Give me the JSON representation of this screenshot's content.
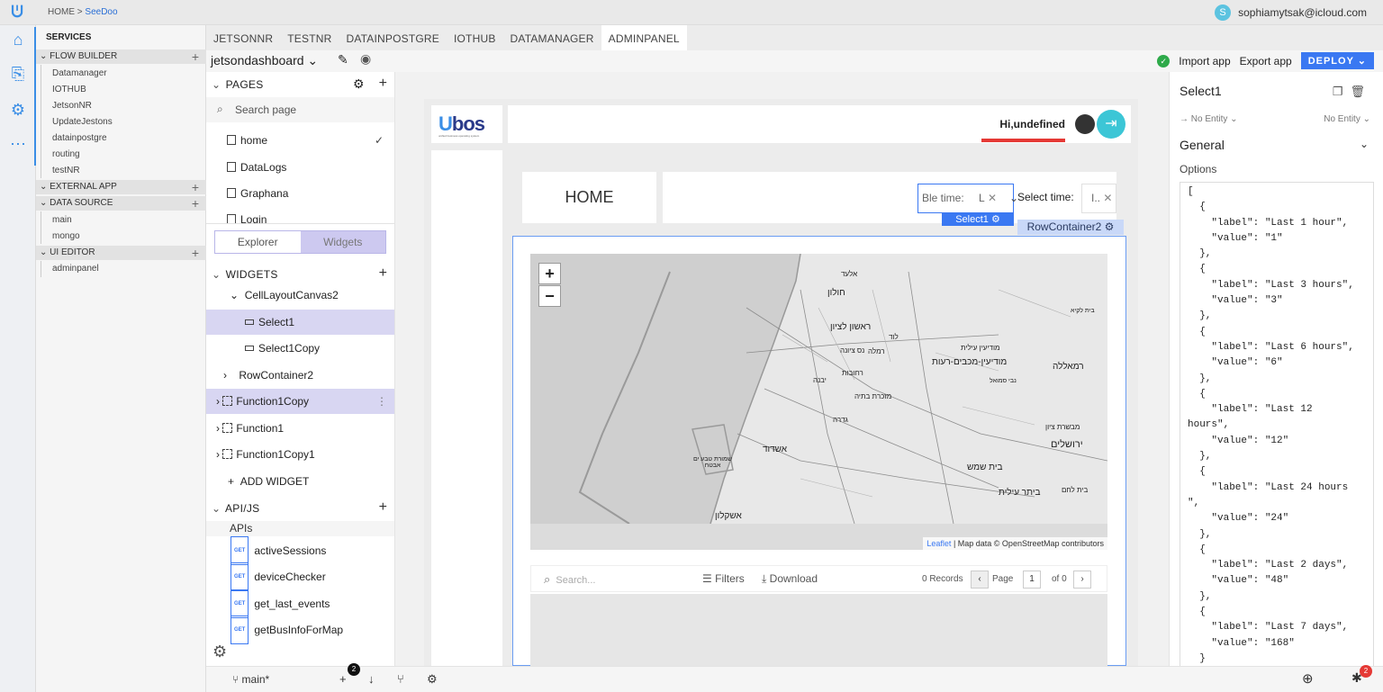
{
  "topbar": {
    "crumb_home": "HOME",
    "crumb_sep": ">",
    "crumb_current": "SeeDoo",
    "user_initial": "S",
    "user_email": "sophiamytsak@icloud.com"
  },
  "services": {
    "title": "SERVICES",
    "flow_builder": {
      "label": "FLOW BUILDER",
      "items": [
        "Datamanager",
        "IOTHUB",
        "JetsonNR",
        "UpdateJestons",
        "datainpostgre",
        "routing",
        "testNR"
      ]
    },
    "external_app": {
      "label": "EXTERNAL APP"
    },
    "data_source": {
      "label": "DATA SOURCE",
      "items": [
        "main",
        "mongo"
      ]
    },
    "ui_editor": {
      "label": "UI EDITOR",
      "items": [
        "adminpanel"
      ]
    }
  },
  "tabs": [
    "JETSONNR",
    "TESTNR",
    "DATAINPOSTGRE",
    "IOTHUB",
    "DATAMANAGER",
    "ADMINPANEL"
  ],
  "toolbar": {
    "app_name": "jetsondashboard",
    "import": "Import app",
    "export": "Export app",
    "deploy": "DEPLOY"
  },
  "pages": {
    "header": "PAGES",
    "search_placeholder": "Search page",
    "items": [
      "home",
      "DataLogs",
      "Graphana",
      "Login"
    ]
  },
  "switch": {
    "explorer": "Explorer",
    "widgets": "Widgets"
  },
  "widgets": {
    "header": "WIDGETS",
    "items": [
      "CellLayoutCanvas2",
      "Select1",
      "Select1Copy",
      "RowContainer2",
      "Function1Copy",
      "Function1",
      "Function1Copy1"
    ],
    "add": "ADD WIDGET"
  },
  "apijs": {
    "header": "API/JS",
    "apis_label": "APIs",
    "method": "GET",
    "items": [
      "activeSessions",
      "deviceChecker",
      "get_last_events",
      "getBusInfoForMap"
    ]
  },
  "canvas": {
    "logo_a": "U",
    "logo_b": "bos",
    "logo_sub": "unified business operating system",
    "greeting": "Hi,undefined",
    "home": "HOME",
    "select1_label": "Ble time:",
    "select1_value": "L",
    "select1_tag": "Select1",
    "select2_label": "Select time:",
    "select2_value": "I..",
    "row_tag": "RowContainer2",
    "map": {
      "zoom_in": "+",
      "zoom_out": "−",
      "attrib_link": "Leaflet",
      "attrib_text": "| Map data © OpenStreetMap contributors",
      "labels": [
        "אלעד",
        "חולון",
        "ראשון לציון",
        "רמלה",
        "לוד",
        "נס ציונה",
        "רחובות",
        "מודיעין עילית",
        "מודיעין-מכבים-רעות",
        "רמאללה",
        "יבנה",
        "מזכרת בתיה",
        "גדרה",
        "אשדוד",
        "ירושלים",
        "מבשרת ציון",
        "בית שמש",
        "ביתר עילית",
        "אשקלון",
        "שמורת טבע ים אבטח",
        "בית לחם",
        "נבי סמואל",
        "בית לקיא"
      ]
    },
    "table": {
      "search": "Search...",
      "filters": "Filters",
      "download": "Download",
      "records": "0 Records",
      "page": "Page",
      "page_num": "1",
      "of": "of 0"
    }
  },
  "rpanel": {
    "title": "Select1",
    "entity_left": "No Entity",
    "entity_right": "No Entity",
    "general": "General",
    "options": "Options",
    "options_json": "[\n  {\n    \"label\": \"Last 1 hour\",\n    \"value\": \"1\"\n  },\n  {\n    \"label\": \"Last 3 hours\",\n    \"value\": \"3\"\n  },\n  {\n    \"label\": \"Last 6 hours\",\n    \"value\": \"6\"\n  },\n  {\n    \"label\": \"Last 12\nhours\",\n    \"value\": \"12\"\n  },\n  {\n    \"label\": \"Last 24 hours\n\",\n    \"value\": \"24\"\n  },\n  {\n    \"label\": \"Last 2 days\",\n    \"value\": \"48\"\n  },\n  {\n    \"label\": \"Last 7 days\",\n    \"value\": \"168\"\n  }"
  },
  "bottom": {
    "branch": "main*",
    "commit_badge": "2",
    "bug_badge": "2"
  },
  "colors": {
    "accent": "#3a78f2",
    "selection": "#d8d6f2",
    "logout": "#3cc6d6",
    "greeting_underline": "#e53935",
    "ok": "#2eaa4a"
  }
}
